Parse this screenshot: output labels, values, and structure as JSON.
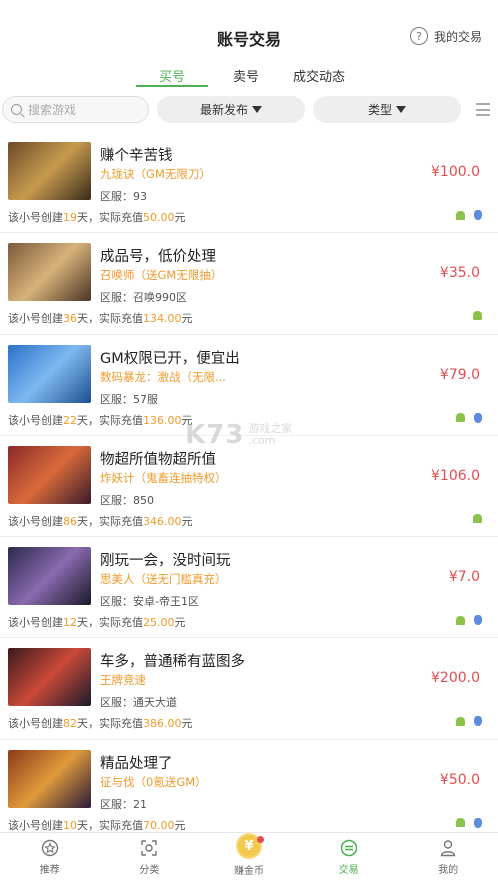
{
  "header": {
    "title": "账号交易",
    "my_trade": "我的交易",
    "help_icon": "question-circle-icon"
  },
  "tabs": [
    {
      "label": "买号",
      "active": true
    },
    {
      "label": "卖号",
      "active": false
    },
    {
      "label": "成交动态",
      "active": false
    }
  ],
  "filters": {
    "search_placeholder": "搜索游戏",
    "sort": "最新发布",
    "type": "类型"
  },
  "listings": [
    {
      "title": "赚个辛苦钱",
      "game": "九珑诀（GM无限刀）",
      "server": "区服：93",
      "price": "¥100.0",
      "meta_prefix": "该小号创建",
      "days": "19",
      "meta_mid": "天，实际充值",
      "recharge": "50.00",
      "meta_suffix": "元",
      "platforms": [
        "android",
        "ios"
      ],
      "thumb_colors": [
        "#6b4a2a",
        "#c79b4e",
        "#3a2a1a"
      ]
    },
    {
      "title": "成品号，低价处理",
      "game": "召唤师（送GM无限抽）",
      "server": "区服：召唤990区",
      "price": "¥35.0",
      "meta_prefix": "该小号创建",
      "days": "36",
      "meta_mid": "天，实际充值",
      "recharge": "134.00",
      "meta_suffix": "元",
      "platforms": [
        "android"
      ],
      "thumb_colors": [
        "#7a5a3a",
        "#d7b27a",
        "#4a3626"
      ]
    },
    {
      "title": "GM权限已开，便宜出",
      "game": "数码暴龙：激战（无限...",
      "server": "区服：57服",
      "price": "¥79.0",
      "meta_prefix": "该小号创建",
      "days": "22",
      "meta_mid": "天，实际充值",
      "recharge": "136.00",
      "meta_suffix": "元",
      "platforms": [
        "android",
        "ios"
      ],
      "thumb_colors": [
        "#2a73c9",
        "#7fb8f0",
        "#1a4f8f"
      ]
    },
    {
      "title": "物超所值物超所值",
      "game": "炸妖计（鬼畜连抽特权）",
      "server": "区服：850",
      "price": "¥106.0",
      "meta_prefix": "该小号创建",
      "days": "86",
      "meta_mid": "天，实际充值",
      "recharge": "346.00",
      "meta_suffix": "元",
      "platforms": [
        "android"
      ],
      "thumb_colors": [
        "#8a2a2a",
        "#d86a3a",
        "#3a1a2a"
      ]
    },
    {
      "title": "刚玩一会，没时间玩",
      "game": "思美人（送无门槛真充）",
      "server": "区服：安卓-帝王1区",
      "price": "¥7.0",
      "meta_prefix": "该小号创建",
      "days": "12",
      "meta_mid": "天，实际充值",
      "recharge": "25.00",
      "meta_suffix": "元",
      "platforms": [
        "android",
        "ios"
      ],
      "thumb_colors": [
        "#2a2a4a",
        "#8a6ab0",
        "#1a1a2a"
      ]
    },
    {
      "title": "车多，普通稀有蓝图多",
      "game": "王牌竞速",
      "server": "区服：通天大道",
      "price": "¥200.0",
      "meta_prefix": "该小号创建",
      "days": "82",
      "meta_mid": "天，实际充值",
      "recharge": "386.00",
      "meta_suffix": "元",
      "platforms": [
        "android",
        "ios"
      ],
      "thumb_colors": [
        "#3a1a1a",
        "#c94a3a",
        "#1a1a2a"
      ]
    },
    {
      "title": "精品处理了",
      "game": "征与伐（0氪送GM）",
      "server": "区服：21",
      "price": "¥50.0",
      "meta_prefix": "该小号创建",
      "days": "10",
      "meta_mid": "天，实际充值",
      "recharge": "70.00",
      "meta_suffix": "元",
      "platforms": [
        "android",
        "ios"
      ],
      "thumb_colors": [
        "#8a3a1a",
        "#e09a3a",
        "#2a1a3a"
      ]
    }
  ],
  "bottom_nav": [
    {
      "label": "推荐",
      "icon": "recommend-icon",
      "active": false
    },
    {
      "label": "分类",
      "icon": "category-icon",
      "active": false
    },
    {
      "label": "赚金币",
      "icon": "coin-icon",
      "coin_symbol": "¥",
      "active": false,
      "badge": true
    },
    {
      "label": "交易",
      "icon": "trade-icon",
      "active": true
    },
    {
      "label": "我的",
      "icon": "profile-icon",
      "active": false
    }
  ],
  "watermark": {
    "logo": "K73",
    "text": "游戏之家",
    "domain": ".com"
  },
  "colors": {
    "accent": "#4caf50",
    "price": "#e34d4d",
    "highlight": "#f39a2b"
  }
}
